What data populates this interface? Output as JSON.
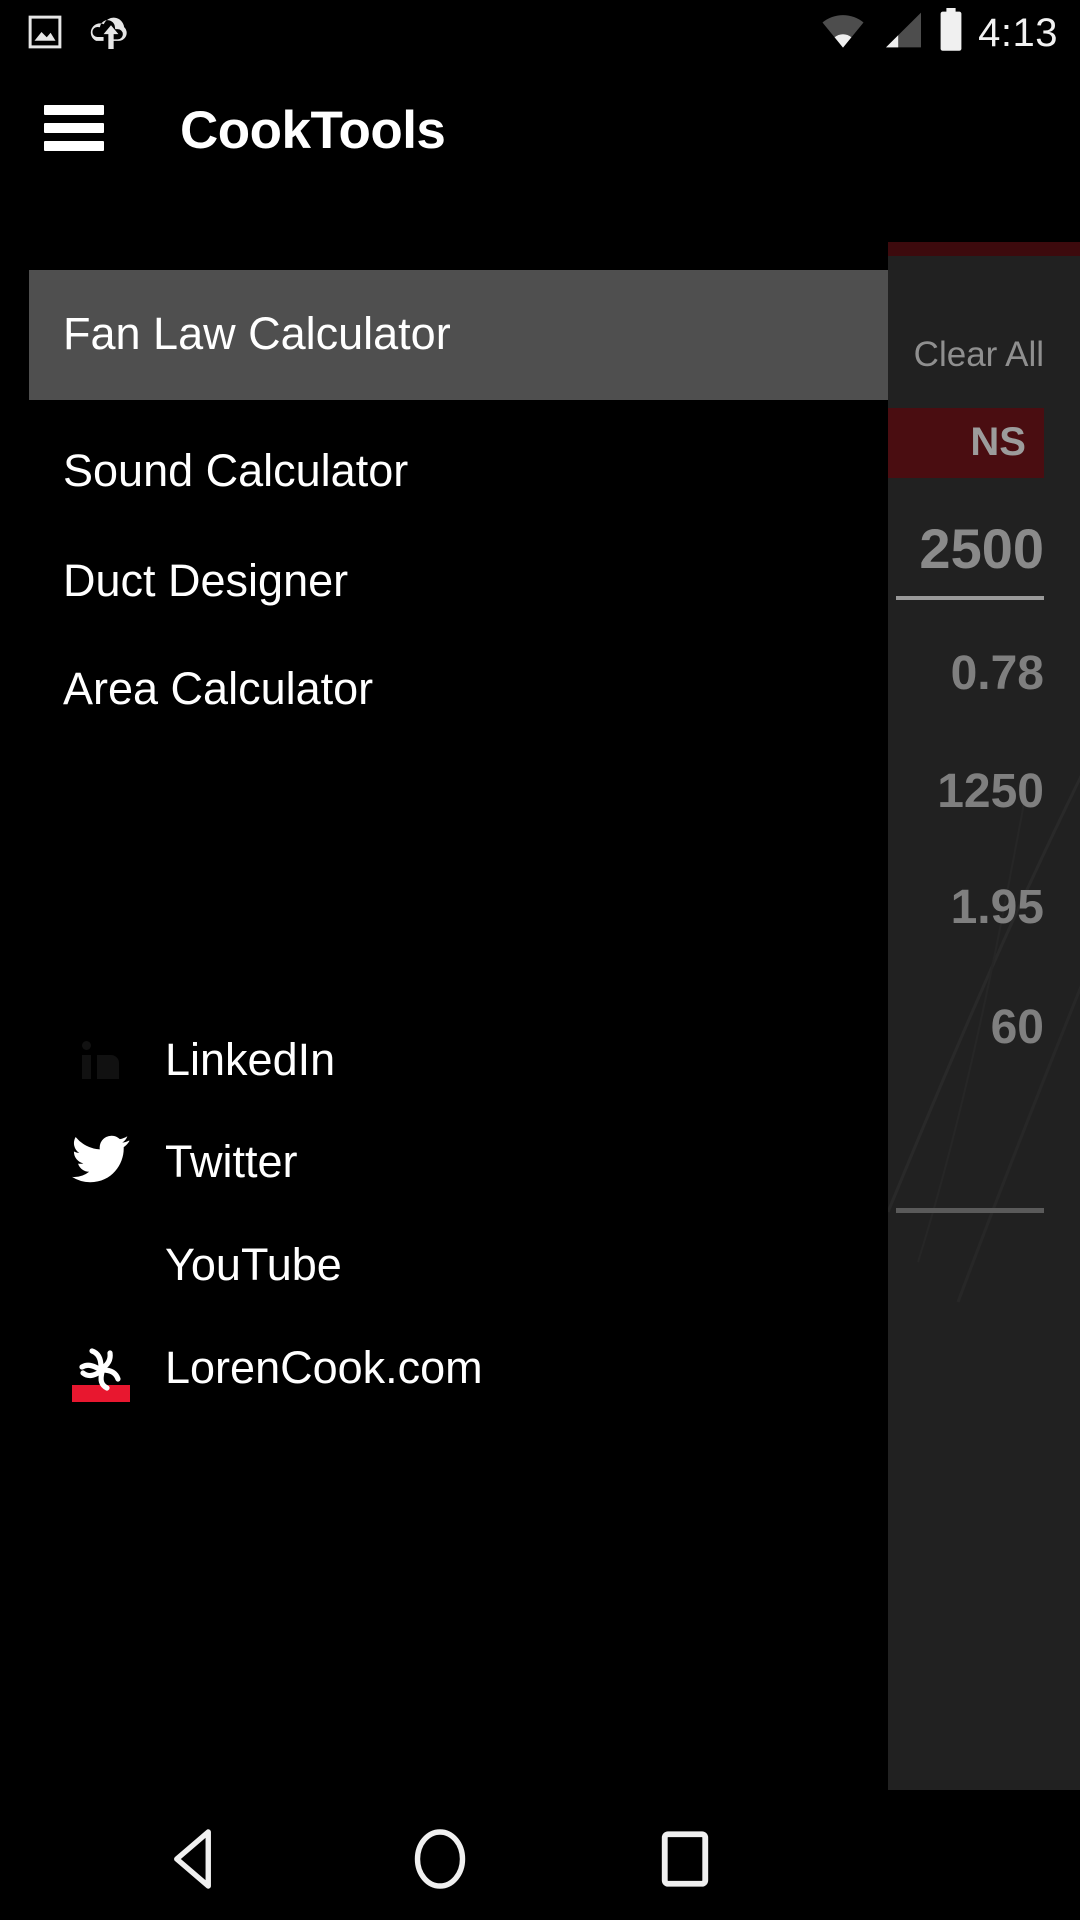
{
  "status_bar": {
    "icons": [
      "screenshot-icon",
      "cloud-upload-icon",
      "wifi-icon",
      "cellular-signal-icon",
      "battery-icon"
    ],
    "time": "4:13"
  },
  "app_bar": {
    "menu_icon": "hamburger-menu-icon",
    "title": "CookTools"
  },
  "drawer": {
    "items": [
      {
        "label": "Fan Law Calculator",
        "selected": true
      },
      {
        "label": "Sound Calculator",
        "selected": false
      },
      {
        "label": "Duct Designer",
        "selected": false
      },
      {
        "label": "Area Calculator",
        "selected": false
      }
    ],
    "social_links": [
      {
        "label": "LinkedIn",
        "icon": "linkedin-icon"
      },
      {
        "label": "Twitter",
        "icon": "twitter-icon"
      },
      {
        "label": "YouTube",
        "icon": "youtube-icon"
      },
      {
        "label": "LorenCook.com",
        "icon": "loren-cook-logo-icon"
      }
    ],
    "selected_highlight_color": "#4f4f4f"
  },
  "content_panel": {
    "clear_all_label": "Clear All",
    "tab_label": "NS",
    "tab_color": "#4a0d11",
    "accent_color": "#3d0a0d",
    "values": [
      "2500",
      "0.78",
      "1250",
      "1.95",
      "60"
    ]
  },
  "nav_bar": {
    "buttons": [
      "back-button",
      "home-button",
      "recents-button"
    ]
  }
}
